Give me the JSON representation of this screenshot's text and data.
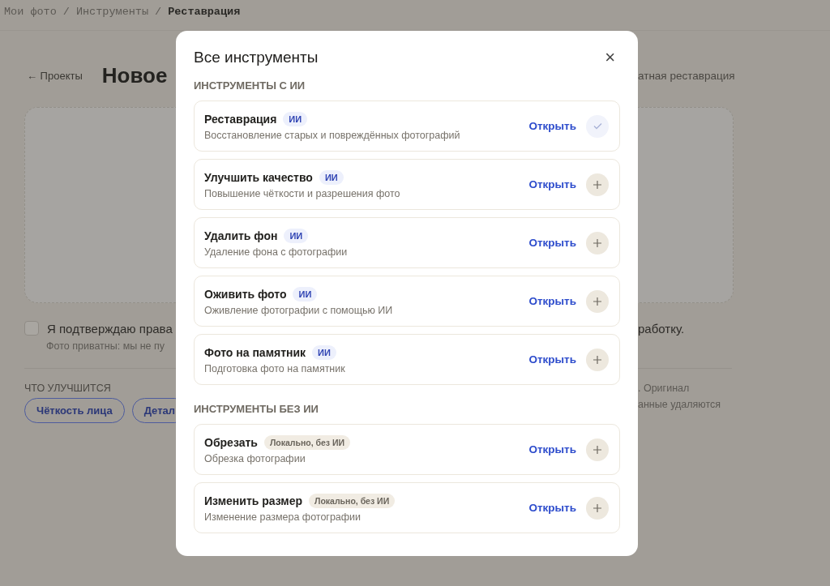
{
  "breadcrumb": [
    {
      "label": "Мои фото",
      "selected": false
    },
    {
      "label": "Инструменты",
      "selected": false
    },
    {
      "label": "Реставрация",
      "selected": true
    }
  ],
  "breadcrumb_separator": "/",
  "page": {
    "back_link": "← Проекты",
    "title": "Новое",
    "subtitle_right": "атная реставрация",
    "consent": {
      "checked": false,
      "label": "Я подтверждаю права",
      "label_right": "работку."
    },
    "privacy_note": "Фото приватны: мы не пу",
    "improve_heading": "ЧТО УЛУЧШИТСЯ",
    "chips": [
      "Чёткость лица",
      "Детал"
    ],
    "note_right": [
      ". Оригинал",
      "анные удаляются"
    ]
  },
  "modal": {
    "title": "Все инструменты",
    "close": "×",
    "sections": [
      {
        "heading": "ИНСТРУМЕНТЫ С ИИ",
        "tools": [
          {
            "name": "Реставрация",
            "badge": "ИИ",
            "kind": "ai",
            "description": "Восстановление старых и повреждённых фотографий",
            "action": "Открыть",
            "added": true
          },
          {
            "name": "Улучшить качество",
            "badge": "ИИ",
            "kind": "ai",
            "description": "Повышение чёткости и разрешения фото",
            "action": "Открыть",
            "added": false
          },
          {
            "name": "Удалить фон",
            "badge": "ИИ",
            "kind": "ai",
            "description": "Удаление фона с фотографии",
            "action": "Открыть",
            "added": false
          },
          {
            "name": "Оживить фото",
            "badge": "ИИ",
            "kind": "ai",
            "description": "Оживление фотографии с помощью ИИ",
            "action": "Открыть",
            "added": false
          },
          {
            "name": "Фото на памятник",
            "badge": "ИИ",
            "kind": "ai",
            "description": "Подготовка фото на памятник",
            "action": "Открыть",
            "added": false
          }
        ]
      },
      {
        "heading": "ИНСТРУМЕНТЫ БЕЗ ИИ",
        "tools": [
          {
            "name": "Обрезать",
            "badge": "Локально, без ИИ",
            "kind": "local",
            "description": "Обрезка фотографии",
            "action": "Открыть",
            "added": false
          },
          {
            "name": "Изменить размер",
            "badge": "Локально, без ИИ",
            "kind": "local",
            "description": "Изменение размера фотографии",
            "action": "Открыть",
            "added": false
          }
        ]
      }
    ]
  }
}
